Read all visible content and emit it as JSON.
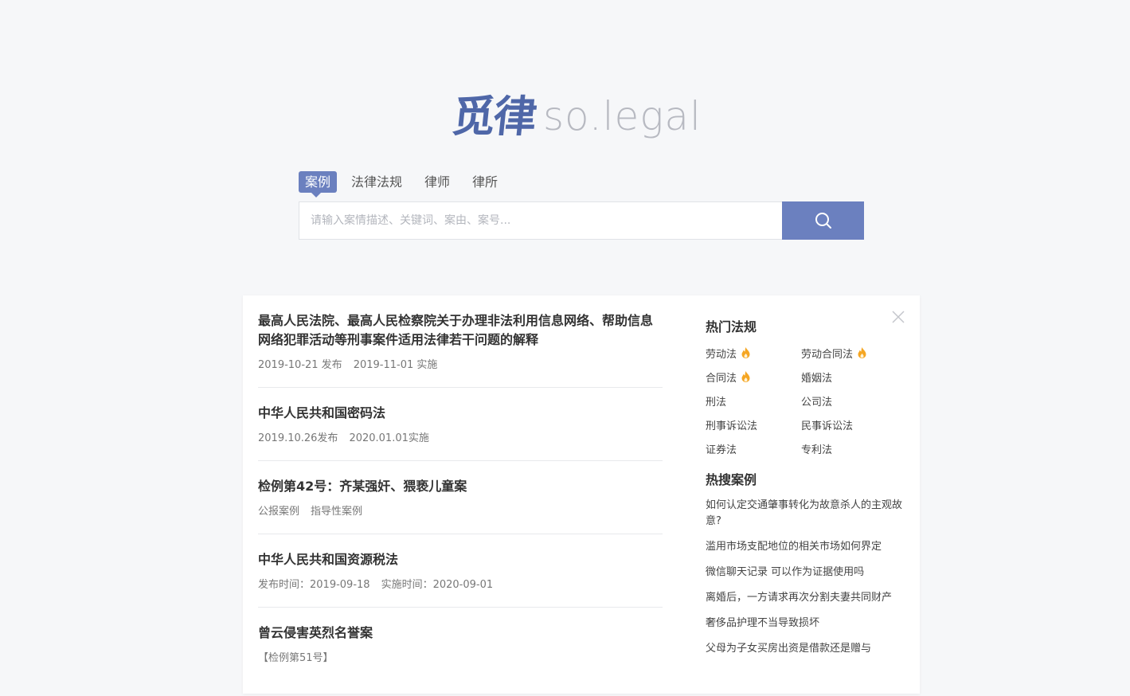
{
  "logo": {
    "cn": "觅律",
    "en": "so.legal"
  },
  "tabs": [
    {
      "label": "案例",
      "active": true
    },
    {
      "label": "法律法规",
      "active": false
    },
    {
      "label": "律师",
      "active": false
    },
    {
      "label": "律所",
      "active": false
    }
  ],
  "search": {
    "placeholder": "请输入案情描述、关键词、案由、案号...",
    "value": ""
  },
  "icons": {
    "search": "search-icon",
    "close": "close-icon",
    "fire": "fire-icon"
  },
  "colors": {
    "brand": "#6b80bf",
    "logo": "#4f67a8",
    "fire": "#f5a623"
  },
  "news": [
    {
      "title": "最高人民法院、最高人民检察院关于办理非法利用信息网络、帮助信息网络犯罪活动等刑事案件适用法律若干问题的解释",
      "meta": [
        "2019-10-21 发布",
        "2019-11-01 实施"
      ]
    },
    {
      "title": "中华人民共和国密码法",
      "meta": [
        "2019.10.26发布",
        "2020.01.01实施"
      ]
    },
    {
      "title": "检例第42号：齐某强奸、猥亵儿童案",
      "meta": [
        "公报案例",
        "指导性案例"
      ]
    },
    {
      "title": "中华人民共和国资源税法",
      "meta": [
        "发布时间：2019-09-18",
        "实施时间：2020-09-01"
      ]
    },
    {
      "title": "曾云侵害英烈名誉案",
      "meta": [
        "【检例第51号】"
      ]
    }
  ],
  "sidebar": {
    "hot_laws_heading": "热门法规",
    "hot_laws": [
      {
        "label": "劳动法",
        "hot": true
      },
      {
        "label": "劳动合同法",
        "hot": true
      },
      {
        "label": "合同法",
        "hot": true
      },
      {
        "label": "婚姻法",
        "hot": false
      },
      {
        "label": "刑法",
        "hot": false
      },
      {
        "label": "公司法",
        "hot": false
      },
      {
        "label": "刑事诉讼法",
        "hot": false
      },
      {
        "label": "民事诉讼法",
        "hot": false
      },
      {
        "label": "证券法",
        "hot": false
      },
      {
        "label": "专利法",
        "hot": false
      }
    ],
    "hot_cases_heading": "热搜案例",
    "hot_cases": [
      "如何认定交通肇事转化为故意杀人的主观故意?",
      "滥用市场支配地位的相关市场如何界定",
      "微信聊天记录 可以作为证据使用吗",
      "离婚后，一方请求再次分割夫妻共同财产",
      "奢侈品护理不当导致损坏",
      "父母为子女买房出资是借款还是赠与"
    ]
  }
}
